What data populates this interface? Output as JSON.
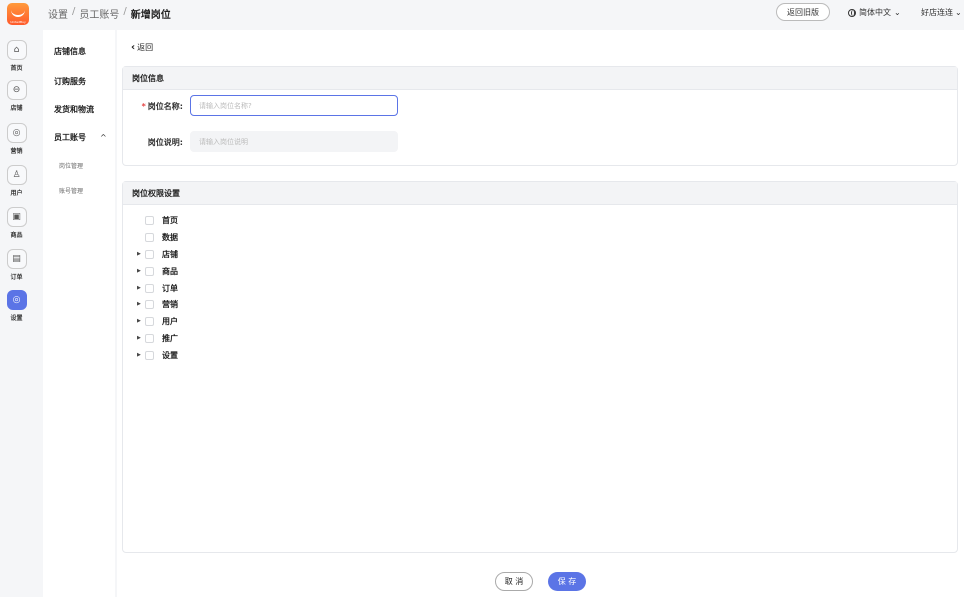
{
  "header": {
    "logo_text": "UnitedBuy",
    "breadcrumb": [
      "设置",
      "员工账号",
      "新增岗位"
    ],
    "breadcrumb_sep": "/",
    "old_version_label": "返回旧版",
    "language_label": "简体中文",
    "shop_label": "好店连连"
  },
  "rail": {
    "items": [
      {
        "label": "首页",
        "icon": "home-icon"
      },
      {
        "label": "店铺",
        "icon": "store-icon"
      },
      {
        "label": "营销",
        "icon": "marketing-icon"
      },
      {
        "label": "用户",
        "icon": "user-icon"
      },
      {
        "label": "商品",
        "icon": "goods-icon"
      },
      {
        "label": "订单",
        "icon": "order-icon"
      },
      {
        "label": "设置",
        "icon": "settings-icon",
        "active": true
      }
    ]
  },
  "subnav": {
    "items": [
      "店铺信息",
      "订购服务",
      "发货和物流",
      "员工账号"
    ],
    "subitems": [
      "岗位管理",
      "账号管理"
    ],
    "expand_caret": "^"
  },
  "main": {
    "back_label": "返回",
    "info_section": {
      "title": "岗位信息",
      "name_label": "岗位名称:",
      "name_required": "*",
      "name_placeholder": "请输入岗位名称?",
      "desc_label": "岗位说明:",
      "desc_placeholder": "请输入岗位说明"
    },
    "perm_section": {
      "title": "岗位权限设置",
      "items": [
        {
          "label": "首页",
          "expandable": false
        },
        {
          "label": "数据",
          "expandable": false
        },
        {
          "label": "店铺",
          "expandable": true
        },
        {
          "label": "商品",
          "expandable": true
        },
        {
          "label": "订单",
          "expandable": true
        },
        {
          "label": "营销",
          "expandable": true
        },
        {
          "label": "用户",
          "expandable": true
        },
        {
          "label": "推广",
          "expandable": true
        },
        {
          "label": "设置",
          "expandable": true
        }
      ]
    },
    "footer": {
      "cancel_label": "取 消",
      "save_label": "保 存"
    }
  },
  "colors": {
    "accent": "#5b74e6",
    "required": "#e54545"
  }
}
